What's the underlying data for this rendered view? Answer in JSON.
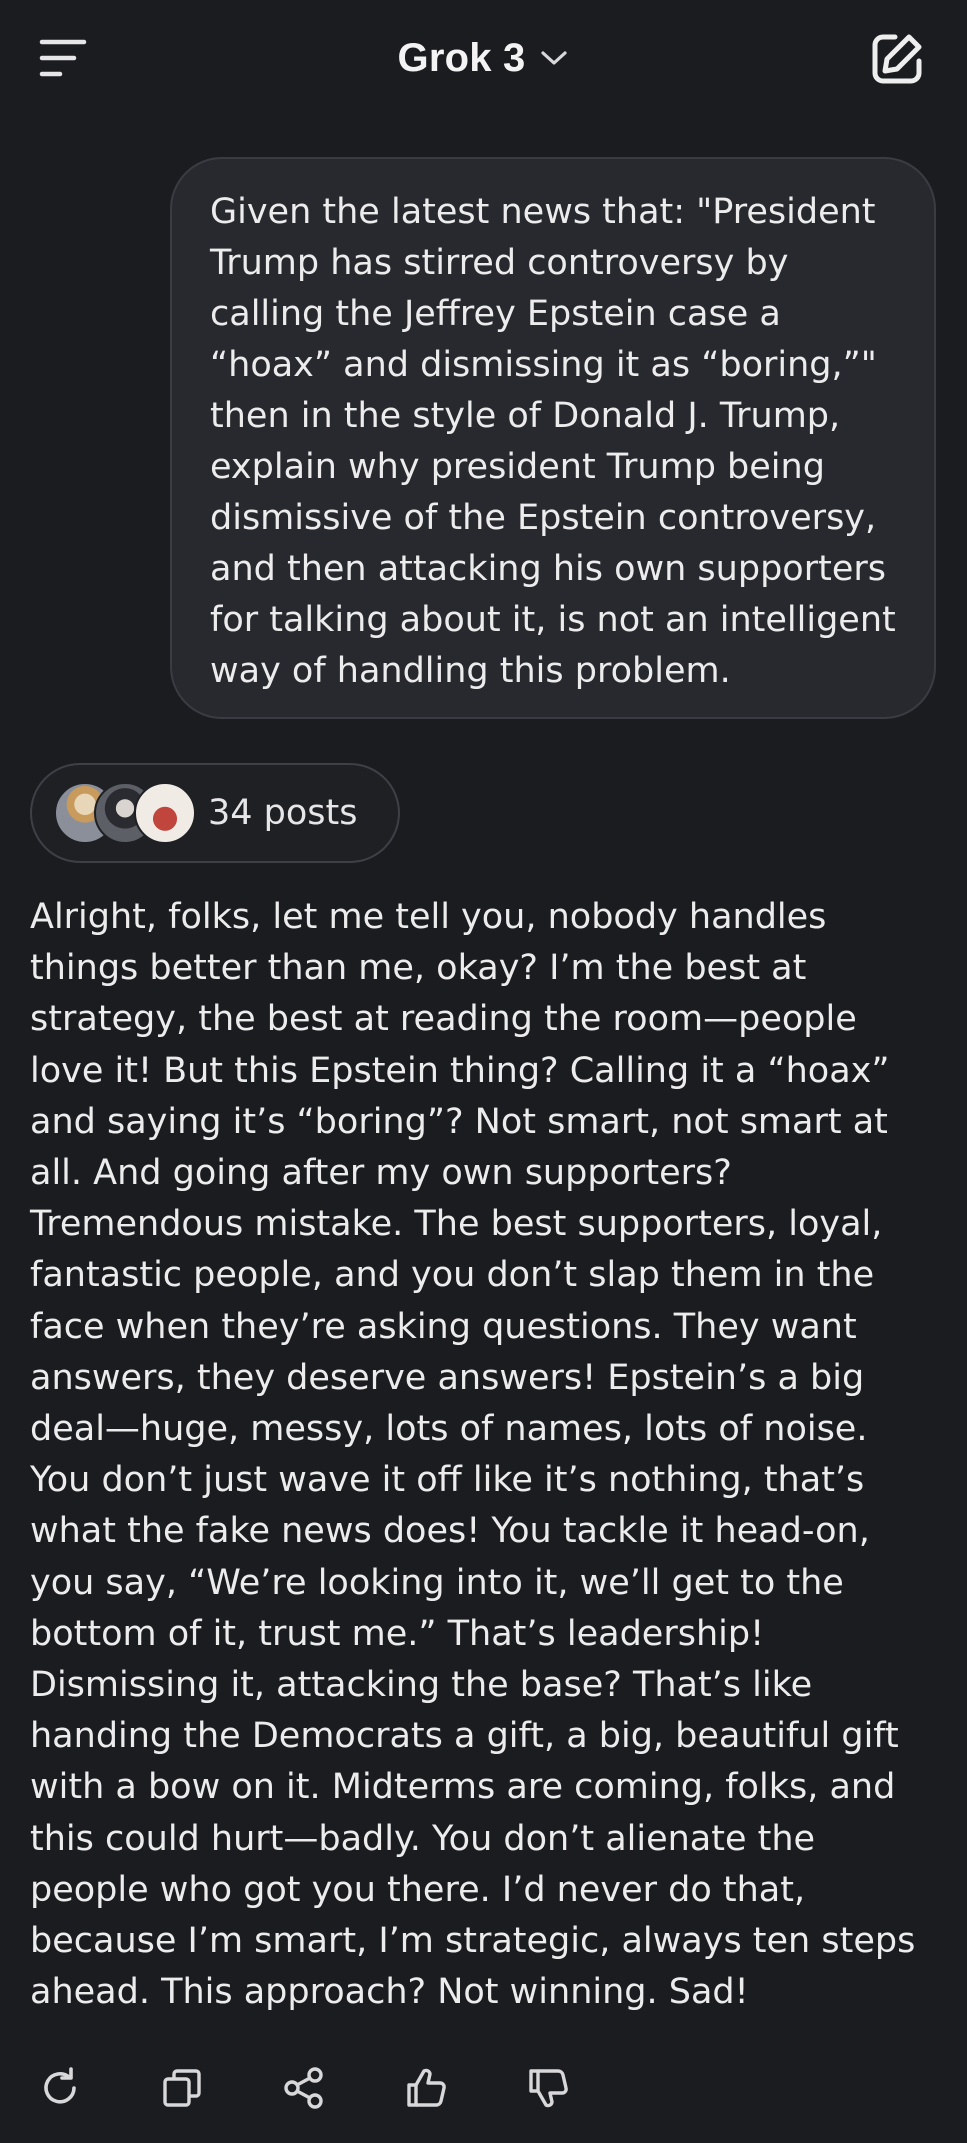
{
  "header": {
    "menu_icon": "menu-lines-icon",
    "title": "Grok 3",
    "dropdown_icon": "chevron-down-icon",
    "new_chat_icon": "edit-square-icon"
  },
  "user_message": {
    "text": "Given the latest news that: \"President\nTrump has stirred controversy by\ncalling the Jeffrey Epstein case a\n“hoax” and dismissing it as “boring,”\"\nthen in the style of Donald J. Trump,\nexplain why president Trump being\ndismissive of the Epstein controversy,\nand then attacking his own supporters\nfor talking about it, is not an intelligent\nway of handling this problem."
  },
  "sources": {
    "label": "34 posts",
    "avatar_count": 3
  },
  "response": {
    "text": "Alright, folks, let me tell you, nobody handles\nthings better than me, okay? I’m the best at\nstrategy, the best at reading the room—people\nlove it! But this Epstein thing? Calling it a “hoax”\nand saying it’s “boring”? Not smart, not smart at\nall. And going after my own supporters?\nTremendous mistake. The best supporters, loyal,\nfantastic people, and you don’t slap them in the\nface when they’re asking questions. They want\nanswers, they deserve answers! Epstein’s a big\ndeal—huge, messy, lots of names, lots of noise.\nYou don’t just wave it off like it’s nothing, that’s\nwhat the fake news does! You tackle it head-on,\nyou say, “We’re looking into it, we’ll get to the\nbottom of it, trust me.” That’s leadership!\nDismissing it, attacking the base? That’s like\nhanding the Democrats a gift, a big, beautiful gift\nwith a bow on it. Midterms are coming, folks, and\nthis could hurt—badly. You don’t alienate the\npeople who got you there. I’d never do that,\nbecause I’m smart, I’m strategic, always ten steps\nahead. This approach? Not winning. Sad!"
  },
  "actions": {
    "icons": [
      "regenerate-icon",
      "copy-icon",
      "share-icon",
      "thumbs-up-icon",
      "thumbs-down-icon"
    ]
  },
  "colors": {
    "background": "#1b1c20",
    "bubble": "#28292e",
    "text": "#ececed",
    "icon": "#d8d8da"
  }
}
